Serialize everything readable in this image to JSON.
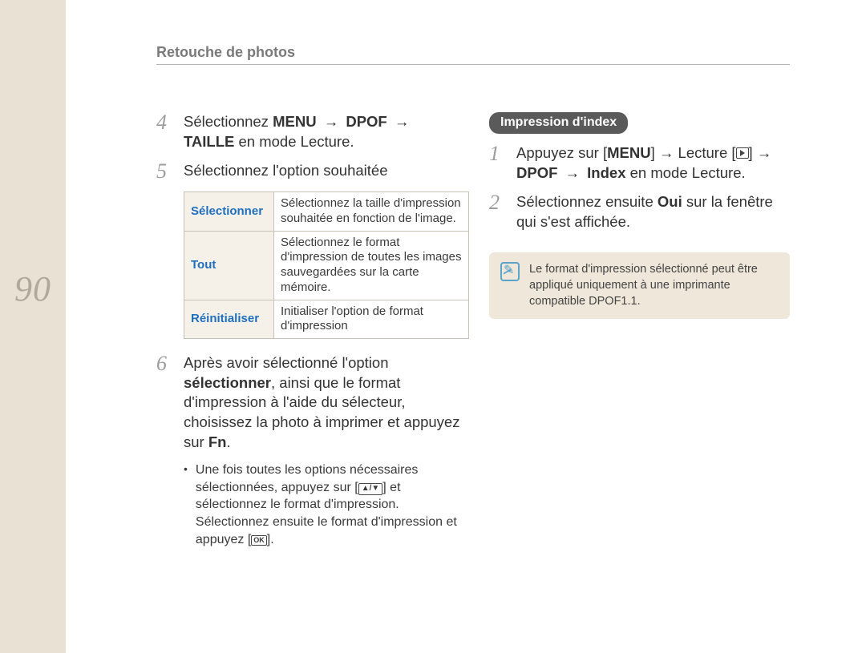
{
  "header": "Retouche de photos",
  "page_number": "90",
  "left": {
    "step4": {
      "num": "4",
      "pre": "Sélectionnez ",
      "b1": "MENU",
      "mid1": " → ",
      "b2": "DPOF",
      "mid2": " → ",
      "b3": "TAILLE",
      "post": " en mode Lecture."
    },
    "step5": {
      "num": "5",
      "text": "Sélectionnez l'option souhaitée"
    },
    "table": [
      {
        "label": "Sélectionner",
        "desc": "Sélectionnez la taille d'impression souhaitée en fonction de l'image."
      },
      {
        "label": "Tout",
        "desc": "Sélectionnez le format d'impression de toutes les images sauvegardées sur la carte mémoire."
      },
      {
        "label": "Réinitialiser",
        "desc": "Initialiser l'option de format d'impression"
      }
    ],
    "step6": {
      "num": "6",
      "pre": "Après avoir sélectionné l'option ",
      "b1": "sélectionner",
      "mid": ", ainsi que le format d'impression à l'aide du sélecteur, choisissez la photo à imprimer et appuyez sur ",
      "b2": "Fn",
      "post": "."
    },
    "bullet": {
      "p1": "Une fois toutes les options nécessaires sélectionnées, appuyez sur [",
      "arrows": "▲/▼",
      "p2": "] et sélectionnez le format d'impression. Sélectionnez ensuite le format d'impression et appuyez [",
      "ok_top": "OK",
      "p3": "]."
    }
  },
  "right": {
    "pill": "Impression d'index",
    "step1": {
      "num": "1",
      "pre": "Appuyez sur [",
      "b1": "MENU",
      "mid1": "] → Lecture [",
      "mid2": "] → ",
      "b2": "DPOF",
      "mid3": " → ",
      "b3": "Index",
      "post": " en mode Lecture."
    },
    "step2": {
      "num": "2",
      "pre": "Sélectionnez ensuite ",
      "b1": "Oui",
      "post": " sur la fenêtre qui s'est affichée."
    },
    "note": "Le format d'impression sélectionné peut être appliqué uniquement à une imprimante compatible DPOF1.1."
  }
}
